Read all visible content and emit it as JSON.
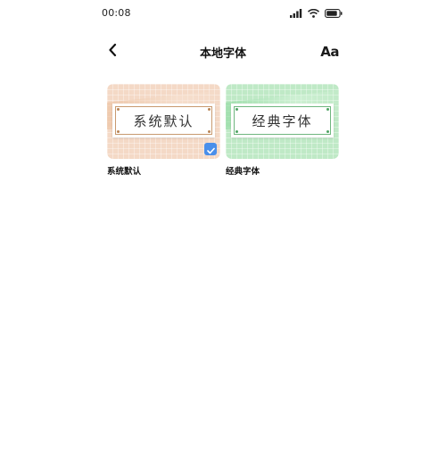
{
  "status_bar": {
    "time": "00:08",
    "icons": [
      "signal-icon",
      "wifi-icon",
      "battery-icon"
    ]
  },
  "nav": {
    "back_icon": "chevron-left-icon",
    "title": "本地字体",
    "font_size_label": "Aa"
  },
  "fonts": [
    {
      "label": "系统默认",
      "preview_text": "系统默认",
      "theme": "peach",
      "selected": true
    },
    {
      "label": "经典字体",
      "preview_text": "经典字体",
      "theme": "mint",
      "selected": false
    }
  ],
  "colors": {
    "peach": "#f4d9c6",
    "mint": "#bfe9c6",
    "check_badge": "#4a8fea"
  }
}
